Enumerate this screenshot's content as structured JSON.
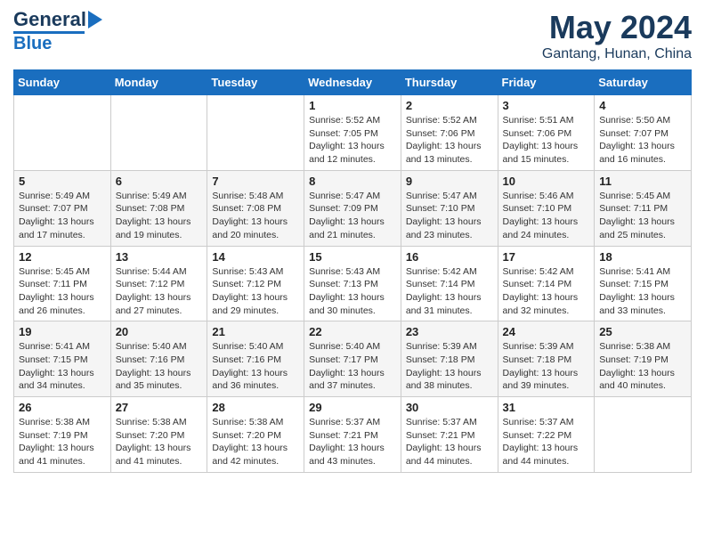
{
  "header": {
    "logo_line1": "General",
    "logo_line2": "Blue",
    "month_year": "May 2024",
    "location": "Gantang, Hunan, China"
  },
  "weekdays": [
    "Sunday",
    "Monday",
    "Tuesday",
    "Wednesday",
    "Thursday",
    "Friday",
    "Saturday"
  ],
  "weeks": [
    [
      {
        "day": "",
        "info": ""
      },
      {
        "day": "",
        "info": ""
      },
      {
        "day": "",
        "info": ""
      },
      {
        "day": "1",
        "info": "Sunrise: 5:52 AM\nSunset: 7:05 PM\nDaylight: 13 hours\nand 12 minutes."
      },
      {
        "day": "2",
        "info": "Sunrise: 5:52 AM\nSunset: 7:06 PM\nDaylight: 13 hours\nand 13 minutes."
      },
      {
        "day": "3",
        "info": "Sunrise: 5:51 AM\nSunset: 7:06 PM\nDaylight: 13 hours\nand 15 minutes."
      },
      {
        "day": "4",
        "info": "Sunrise: 5:50 AM\nSunset: 7:07 PM\nDaylight: 13 hours\nand 16 minutes."
      }
    ],
    [
      {
        "day": "5",
        "info": "Sunrise: 5:49 AM\nSunset: 7:07 PM\nDaylight: 13 hours\nand 17 minutes."
      },
      {
        "day": "6",
        "info": "Sunrise: 5:49 AM\nSunset: 7:08 PM\nDaylight: 13 hours\nand 19 minutes."
      },
      {
        "day": "7",
        "info": "Sunrise: 5:48 AM\nSunset: 7:08 PM\nDaylight: 13 hours\nand 20 minutes."
      },
      {
        "day": "8",
        "info": "Sunrise: 5:47 AM\nSunset: 7:09 PM\nDaylight: 13 hours\nand 21 minutes."
      },
      {
        "day": "9",
        "info": "Sunrise: 5:47 AM\nSunset: 7:10 PM\nDaylight: 13 hours\nand 23 minutes."
      },
      {
        "day": "10",
        "info": "Sunrise: 5:46 AM\nSunset: 7:10 PM\nDaylight: 13 hours\nand 24 minutes."
      },
      {
        "day": "11",
        "info": "Sunrise: 5:45 AM\nSunset: 7:11 PM\nDaylight: 13 hours\nand 25 minutes."
      }
    ],
    [
      {
        "day": "12",
        "info": "Sunrise: 5:45 AM\nSunset: 7:11 PM\nDaylight: 13 hours\nand 26 minutes."
      },
      {
        "day": "13",
        "info": "Sunrise: 5:44 AM\nSunset: 7:12 PM\nDaylight: 13 hours\nand 27 minutes."
      },
      {
        "day": "14",
        "info": "Sunrise: 5:43 AM\nSunset: 7:12 PM\nDaylight: 13 hours\nand 29 minutes."
      },
      {
        "day": "15",
        "info": "Sunrise: 5:43 AM\nSunset: 7:13 PM\nDaylight: 13 hours\nand 30 minutes."
      },
      {
        "day": "16",
        "info": "Sunrise: 5:42 AM\nSunset: 7:14 PM\nDaylight: 13 hours\nand 31 minutes."
      },
      {
        "day": "17",
        "info": "Sunrise: 5:42 AM\nSunset: 7:14 PM\nDaylight: 13 hours\nand 32 minutes."
      },
      {
        "day": "18",
        "info": "Sunrise: 5:41 AM\nSunset: 7:15 PM\nDaylight: 13 hours\nand 33 minutes."
      }
    ],
    [
      {
        "day": "19",
        "info": "Sunrise: 5:41 AM\nSunset: 7:15 PM\nDaylight: 13 hours\nand 34 minutes."
      },
      {
        "day": "20",
        "info": "Sunrise: 5:40 AM\nSunset: 7:16 PM\nDaylight: 13 hours\nand 35 minutes."
      },
      {
        "day": "21",
        "info": "Sunrise: 5:40 AM\nSunset: 7:16 PM\nDaylight: 13 hours\nand 36 minutes."
      },
      {
        "day": "22",
        "info": "Sunrise: 5:40 AM\nSunset: 7:17 PM\nDaylight: 13 hours\nand 37 minutes."
      },
      {
        "day": "23",
        "info": "Sunrise: 5:39 AM\nSunset: 7:18 PM\nDaylight: 13 hours\nand 38 minutes."
      },
      {
        "day": "24",
        "info": "Sunrise: 5:39 AM\nSunset: 7:18 PM\nDaylight: 13 hours\nand 39 minutes."
      },
      {
        "day": "25",
        "info": "Sunrise: 5:38 AM\nSunset: 7:19 PM\nDaylight: 13 hours\nand 40 minutes."
      }
    ],
    [
      {
        "day": "26",
        "info": "Sunrise: 5:38 AM\nSunset: 7:19 PM\nDaylight: 13 hours\nand 41 minutes."
      },
      {
        "day": "27",
        "info": "Sunrise: 5:38 AM\nSunset: 7:20 PM\nDaylight: 13 hours\nand 41 minutes."
      },
      {
        "day": "28",
        "info": "Sunrise: 5:38 AM\nSunset: 7:20 PM\nDaylight: 13 hours\nand 42 minutes."
      },
      {
        "day": "29",
        "info": "Sunrise: 5:37 AM\nSunset: 7:21 PM\nDaylight: 13 hours\nand 43 minutes."
      },
      {
        "day": "30",
        "info": "Sunrise: 5:37 AM\nSunset: 7:21 PM\nDaylight: 13 hours\nand 44 minutes."
      },
      {
        "day": "31",
        "info": "Sunrise: 5:37 AM\nSunset: 7:22 PM\nDaylight: 13 hours\nand 44 minutes."
      },
      {
        "day": "",
        "info": ""
      }
    ]
  ]
}
